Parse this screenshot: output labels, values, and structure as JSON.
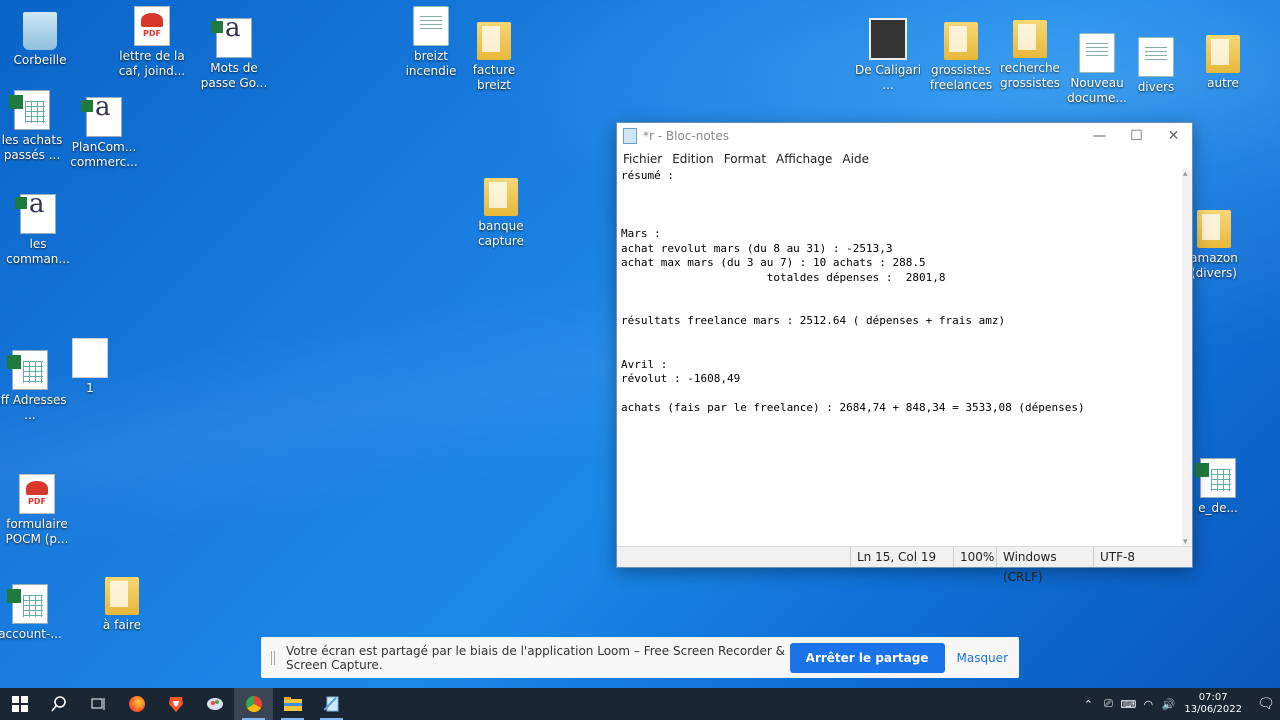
{
  "desktop": {
    "icons": [
      {
        "label": "Corbeille",
        "type": "bin"
      },
      {
        "label": "lettre de la caf, joind...",
        "type": "pdf"
      },
      {
        "label": "Mots de passe Go...",
        "type": "a"
      },
      {
        "label": "breizt incendie",
        "type": "file"
      },
      {
        "label": "facture breizt",
        "type": "folder"
      },
      {
        "label": "De Caligari ...",
        "type": "video"
      },
      {
        "label": "grossistes freelances",
        "type": "folder"
      },
      {
        "label": "recherche grossistes",
        "type": "folder"
      },
      {
        "label": "Nouveau docume...",
        "type": "file"
      },
      {
        "label": "divers",
        "type": "file"
      },
      {
        "label": "autre",
        "type": "folder"
      },
      {
        "label": "les achats passés ...",
        "type": "xls"
      },
      {
        "label": "PlanCom... commerc...",
        "type": "a"
      },
      {
        "label": "les comman...",
        "type": "a"
      },
      {
        "label": "banque capture",
        "type": "folder"
      },
      {
        "label": "amazon (divers)",
        "type": "folder"
      },
      {
        "label": "eff Adresses ...",
        "type": "xls"
      },
      {
        "label": "1",
        "type": "blank"
      },
      {
        "label": "e_de...",
        "type": "xls"
      },
      {
        "label": "formulaire POCM (p...",
        "type": "pdf"
      },
      {
        "label": "account-...",
        "type": "xls"
      },
      {
        "label": "à faire",
        "type": "folder"
      }
    ]
  },
  "notepad": {
    "title": "*r - Bloc-notes",
    "controls": {
      "minimize": "—",
      "maximize": "☐",
      "close": "✕"
    },
    "menu": [
      "Fichier",
      "Edition",
      "Format",
      "Affichage",
      "Aide"
    ],
    "content": "résumé :\n\n\n\nMars :\nachat revolut mars (du 8 au 31) : -2513,3\nachat max mars (du 3 au 7) : 10 achats : 288.5\n                      totaldes dépenses :  2801,8\n\n\nrésultats freelance mars : 2512.64 ( dépenses + frais amz)\n\n\nAvril :\nrévolut : -1608,49\n\nachats (fais par le freelance) : 2684,74 + 848,34 = 3533,08 (dépenses)",
    "status": {
      "position": "Ln 15, Col 19",
      "zoom": "100%",
      "line_ending": "Windows (CRLF)",
      "encoding": "UTF-8"
    }
  },
  "loom": {
    "message": "Votre écran est partagé par le biais de l'application Loom – Free Screen Recorder & Screen Capture.",
    "stop_label": "Arrêter le partage",
    "hide_label": "Masquer"
  },
  "taskbar": {
    "icons": [
      "windows-start-icon",
      "search-icon",
      "task-view-icon",
      "firefox-icon",
      "brave-icon",
      "app-icon",
      "chrome-icon",
      "file-explorer-icon",
      "notepad-icon"
    ],
    "time": "07:07",
    "date": "13/06/2022",
    "accent": "#1a73e8"
  }
}
